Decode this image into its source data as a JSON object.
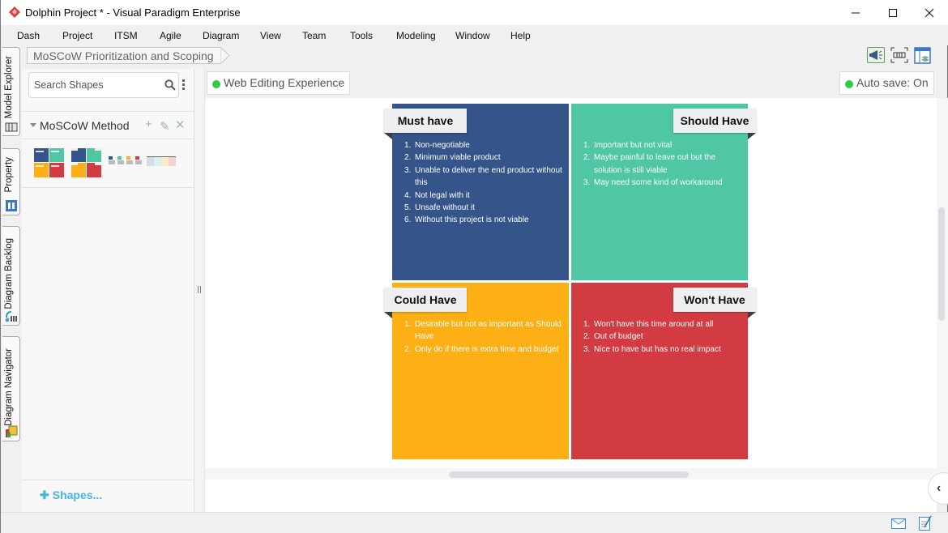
{
  "window": {
    "title": "Dolphin Project * - Visual Paradigm Enterprise",
    "controls": {
      "minimize": "minimize",
      "maximize": "maximize",
      "close": "close"
    }
  },
  "menu": [
    "Dash",
    "Project",
    "ITSM",
    "Agile",
    "Diagram",
    "View",
    "Team",
    "Tools",
    "Modeling",
    "Window",
    "Help"
  ],
  "side_tabs": [
    "Model Explorer",
    "Property",
    "Diagram Backlog",
    "Diagram Navigator"
  ],
  "breadcrumb": "MoSCoW Prioritization and Scoping",
  "toolbar_icons": [
    "megaphone-icon",
    "fit-diagram-icon",
    "layers-panel-icon"
  ],
  "shapes_panel": {
    "search_placeholder": "Search Shapes",
    "group_title": "MoSCoW Method",
    "group_actions": {
      "add": "+",
      "edit": "✎",
      "close": "✕"
    },
    "thumbnails": [
      "moscow-grid-shape",
      "moscow-grid-labeled-shape",
      "moscow-cards-shape",
      "moscow-columns-shape"
    ],
    "add_shapes_label": "Shapes..."
  },
  "canvas_header": {
    "mode_label": "Web Editing Experience",
    "autosave_label": "Auto save: On",
    "status_color": "#2ecc40"
  },
  "moscow": {
    "must": {
      "title": "Must have",
      "color": "#34548a",
      "items": [
        "Non-negotiable",
        "Minimum viable product",
        "Unable to deliver the end product without this",
        "Not legal with it",
        "Unsafe without it",
        "Without this project is not viable"
      ]
    },
    "should": {
      "title": "Should Have",
      "color": "#4fc6a4",
      "items": [
        "Important but not vital",
        "Maybe painful to leave out but the solution is still viable",
        "May need some kind of workaround"
      ]
    },
    "could": {
      "title": "Could Have",
      "color": "#fdb015",
      "items": [
        "Desirable but not as important as Should Have",
        "Only do if there is extra time and budget"
      ]
    },
    "wont": {
      "title": "Won't Have",
      "color": "#d23b42",
      "items": [
        "Won't have this time around at all",
        "Out of budget",
        "Nice to have but has no real impact"
      ]
    }
  },
  "statusbar": {
    "icons": [
      "mail-icon",
      "notes-icon"
    ]
  }
}
